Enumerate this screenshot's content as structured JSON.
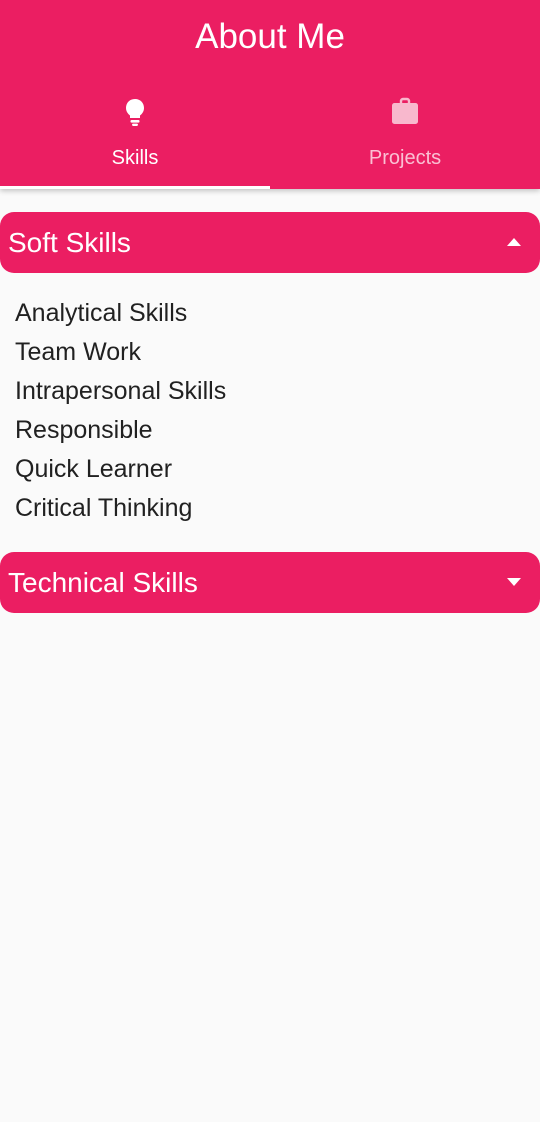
{
  "app_bar": {
    "title": "About Me",
    "background_color": "#eb1e62",
    "tabs": [
      {
        "label": "Skills",
        "icon": "lightbulb-icon",
        "selected": true
      },
      {
        "label": "Projects",
        "icon": "briefcase-icon",
        "selected": false
      }
    ]
  },
  "panels": [
    {
      "title": "Soft Skills",
      "expanded": true,
      "arrow_icon": "arrow-up-icon",
      "items": [
        "Analytical Skills",
        "Team Work",
        "Intrapersonal Skills",
        "Responsible",
        "Quick Learner",
        "Critical Thinking"
      ]
    },
    {
      "title": "Technical Skills",
      "expanded": false,
      "arrow_icon": "arrow-down-icon",
      "items": []
    }
  ]
}
